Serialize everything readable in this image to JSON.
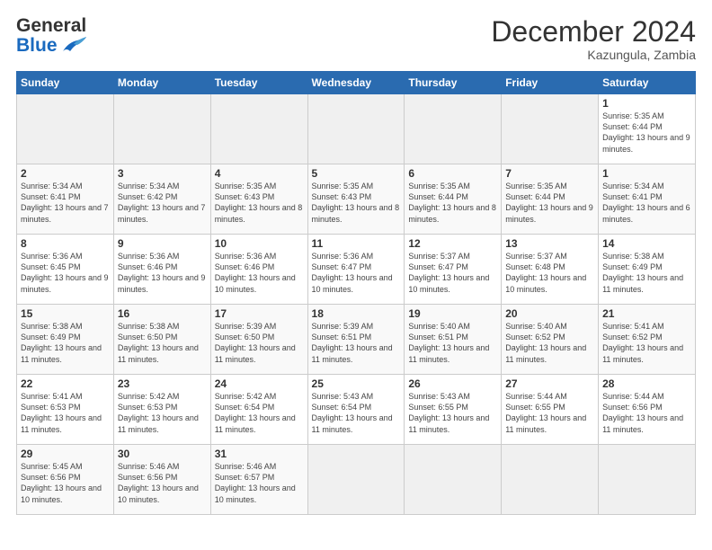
{
  "header": {
    "logo_line1": "General",
    "logo_line2": "Blue",
    "title": "December 2024",
    "subtitle": "Kazungula, Zambia"
  },
  "calendar": {
    "days_of_week": [
      "Sunday",
      "Monday",
      "Tuesday",
      "Wednesday",
      "Thursday",
      "Friday",
      "Saturday"
    ],
    "weeks": [
      [
        {
          "day": "",
          "empty": true
        },
        {
          "day": "",
          "empty": true
        },
        {
          "day": "",
          "empty": true
        },
        {
          "day": "",
          "empty": true
        },
        {
          "day": "",
          "empty": true
        },
        {
          "day": "",
          "empty": true
        },
        {
          "day": "1",
          "sunrise": "5:35 AM",
          "sunset": "6:44 PM",
          "daylight": "13 hours and 9 minutes."
        }
      ],
      [
        {
          "day": "2",
          "sunrise": "5:34 AM",
          "sunset": "6:41 PM",
          "daylight": "13 hours and 7 minutes."
        },
        {
          "day": "3",
          "sunrise": "5:34 AM",
          "sunset": "6:42 PM",
          "daylight": "13 hours and 7 minutes."
        },
        {
          "day": "4",
          "sunrise": "5:35 AM",
          "sunset": "6:43 PM",
          "daylight": "13 hours and 8 minutes."
        },
        {
          "day": "5",
          "sunrise": "5:35 AM",
          "sunset": "6:43 PM",
          "daylight": "13 hours and 8 minutes."
        },
        {
          "day": "6",
          "sunrise": "5:35 AM",
          "sunset": "6:44 PM",
          "daylight": "13 hours and 8 minutes."
        },
        {
          "day": "7",
          "sunrise": "5:35 AM",
          "sunset": "6:44 PM",
          "daylight": "13 hours and 9 minutes."
        },
        {
          "day": "1",
          "sunrise": "5:34 AM",
          "sunset": "6:41 PM",
          "daylight": "13 hours and 6 minutes."
        }
      ],
      [
        {
          "day": "1",
          "sunrise": "5:34 AM",
          "sunset": "6:41 PM",
          "daylight": "13 hours and 6 minutes."
        },
        {
          "day": "2",
          "sunrise": "5:34 AM",
          "sunset": "6:41 PM",
          "daylight": "13 hours and 7 minutes."
        },
        {
          "day": "3",
          "sunrise": "5:34 AM",
          "sunset": "6:42 PM",
          "daylight": "13 hours and 7 minutes."
        },
        {
          "day": "4",
          "sunrise": "5:35 AM",
          "sunset": "6:43 PM",
          "daylight": "13 hours and 8 minutes."
        },
        {
          "day": "5",
          "sunrise": "5:35 AM",
          "sunset": "6:43 PM",
          "daylight": "13 hours and 8 minutes."
        },
        {
          "day": "6",
          "sunrise": "5:35 AM",
          "sunset": "6:44 PM",
          "daylight": "13 hours and 8 minutes."
        },
        {
          "day": "7",
          "sunrise": "5:35 AM",
          "sunset": "6:44 PM",
          "daylight": "13 hours and 9 minutes."
        }
      ]
    ],
    "rows": [
      {
        "cells": [
          {
            "day": "",
            "empty": true
          },
          {
            "day": "",
            "empty": true
          },
          {
            "day": "",
            "empty": true
          },
          {
            "day": "",
            "empty": true
          },
          {
            "day": "",
            "empty": true
          },
          {
            "day": "",
            "empty": true
          },
          {
            "day": "1",
            "sunrise": "Sunrise: 5:35 AM",
            "sunset": "Sunset: 6:44 PM",
            "daylight": "Daylight: 13 hours and 9 minutes."
          }
        ]
      },
      {
        "cells": [
          {
            "day": "2",
            "sunrise": "Sunrise: 5:34 AM",
            "sunset": "Sunset: 6:41 PM",
            "daylight": "Daylight: 13 hours and 7 minutes."
          },
          {
            "day": "3",
            "sunrise": "Sunrise: 5:34 AM",
            "sunset": "Sunset: 6:42 PM",
            "daylight": "Daylight: 13 hours and 7 minutes."
          },
          {
            "day": "4",
            "sunrise": "Sunrise: 5:35 AM",
            "sunset": "Sunset: 6:43 PM",
            "daylight": "Daylight: 13 hours and 8 minutes."
          },
          {
            "day": "5",
            "sunrise": "Sunrise: 5:35 AM",
            "sunset": "Sunset: 6:43 PM",
            "daylight": "Daylight: 13 hours and 8 minutes."
          },
          {
            "day": "6",
            "sunrise": "Sunrise: 5:35 AM",
            "sunset": "Sunset: 6:44 PM",
            "daylight": "Daylight: 13 hours and 8 minutes."
          },
          {
            "day": "7",
            "sunrise": "Sunrise: 5:35 AM",
            "sunset": "Sunset: 6:44 PM",
            "daylight": "Daylight: 13 hours and 9 minutes."
          },
          {
            "day": "1",
            "sunrise": "Sunrise: 5:34 AM",
            "sunset": "Sunset: 6:41 PM",
            "daylight": "Daylight: 13 hours and 6 minutes."
          }
        ]
      },
      {
        "cells": [
          {
            "day": "8",
            "sunrise": "Sunrise: 5:36 AM",
            "sunset": "Sunset: 6:45 PM",
            "daylight": "Daylight: 13 hours and 9 minutes."
          },
          {
            "day": "9",
            "sunrise": "Sunrise: 5:36 AM",
            "sunset": "Sunset: 6:46 PM",
            "daylight": "Daylight: 13 hours and 9 minutes."
          },
          {
            "day": "10",
            "sunrise": "Sunrise: 5:36 AM",
            "sunset": "Sunset: 6:46 PM",
            "daylight": "Daylight: 13 hours and 10 minutes."
          },
          {
            "day": "11",
            "sunrise": "Sunrise: 5:36 AM",
            "sunset": "Sunset: 6:47 PM",
            "daylight": "Daylight: 13 hours and 10 minutes."
          },
          {
            "day": "12",
            "sunrise": "Sunrise: 5:37 AM",
            "sunset": "Sunset: 6:47 PM",
            "daylight": "Daylight: 13 hours and 10 minutes."
          },
          {
            "day": "13",
            "sunrise": "Sunrise: 5:37 AM",
            "sunset": "Sunset: 6:48 PM",
            "daylight": "Daylight: 13 hours and 10 minutes."
          },
          {
            "day": "14",
            "sunrise": "Sunrise: 5:38 AM",
            "sunset": "Sunset: 6:49 PM",
            "daylight": "Daylight: 13 hours and 11 minutes."
          }
        ]
      },
      {
        "cells": [
          {
            "day": "15",
            "sunrise": "Sunrise: 5:38 AM",
            "sunset": "Sunset: 6:49 PM",
            "daylight": "Daylight: 13 hours and 11 minutes."
          },
          {
            "day": "16",
            "sunrise": "Sunrise: 5:38 AM",
            "sunset": "Sunset: 6:50 PM",
            "daylight": "Daylight: 13 hours and 11 minutes."
          },
          {
            "day": "17",
            "sunrise": "Sunrise: 5:39 AM",
            "sunset": "Sunset: 6:50 PM",
            "daylight": "Daylight: 13 hours and 11 minutes."
          },
          {
            "day": "18",
            "sunrise": "Sunrise: 5:39 AM",
            "sunset": "Sunset: 6:51 PM",
            "daylight": "Daylight: 13 hours and 11 minutes."
          },
          {
            "day": "19",
            "sunrise": "Sunrise: 5:40 AM",
            "sunset": "Sunset: 6:51 PM",
            "daylight": "Daylight: 13 hours and 11 minutes."
          },
          {
            "day": "20",
            "sunrise": "Sunrise: 5:40 AM",
            "sunset": "Sunset: 6:52 PM",
            "daylight": "Daylight: 13 hours and 11 minutes."
          },
          {
            "day": "21",
            "sunrise": "Sunrise: 5:41 AM",
            "sunset": "Sunset: 6:52 PM",
            "daylight": "Daylight: 13 hours and 11 minutes."
          }
        ]
      },
      {
        "cells": [
          {
            "day": "22",
            "sunrise": "Sunrise: 5:41 AM",
            "sunset": "Sunset: 6:53 PM",
            "daylight": "Daylight: 13 hours and 11 minutes."
          },
          {
            "day": "23",
            "sunrise": "Sunrise: 5:42 AM",
            "sunset": "Sunset: 6:53 PM",
            "daylight": "Daylight: 13 hours and 11 minutes."
          },
          {
            "day": "24",
            "sunrise": "Sunrise: 5:42 AM",
            "sunset": "Sunset: 6:54 PM",
            "daylight": "Daylight: 13 hours and 11 minutes."
          },
          {
            "day": "25",
            "sunrise": "Sunrise: 5:43 AM",
            "sunset": "Sunset: 6:54 PM",
            "daylight": "Daylight: 13 hours and 11 minutes."
          },
          {
            "day": "26",
            "sunrise": "Sunrise: 5:43 AM",
            "sunset": "Sunset: 6:55 PM",
            "daylight": "Daylight: 13 hours and 11 minutes."
          },
          {
            "day": "27",
            "sunrise": "Sunrise: 5:44 AM",
            "sunset": "Sunset: 6:55 PM",
            "daylight": "Daylight: 13 hours and 11 minutes."
          },
          {
            "day": "28",
            "sunrise": "Sunrise: 5:44 AM",
            "sunset": "Sunset: 6:56 PM",
            "daylight": "Daylight: 13 hours and 11 minutes."
          }
        ]
      },
      {
        "cells": [
          {
            "day": "29",
            "sunrise": "Sunrise: 5:45 AM",
            "sunset": "Sunset: 6:56 PM",
            "daylight": "Daylight: 13 hours and 10 minutes."
          },
          {
            "day": "30",
            "sunrise": "Sunrise: 5:46 AM",
            "sunset": "Sunset: 6:56 PM",
            "daylight": "Daylight: 13 hours and 10 minutes."
          },
          {
            "day": "31",
            "sunrise": "Sunrise: 5:46 AM",
            "sunset": "Sunset: 6:57 PM",
            "daylight": "Daylight: 13 hours and 10 minutes."
          },
          {
            "day": "",
            "empty": true
          },
          {
            "day": "",
            "empty": true
          },
          {
            "day": "",
            "empty": true
          },
          {
            "day": "",
            "empty": true
          }
        ]
      }
    ]
  }
}
